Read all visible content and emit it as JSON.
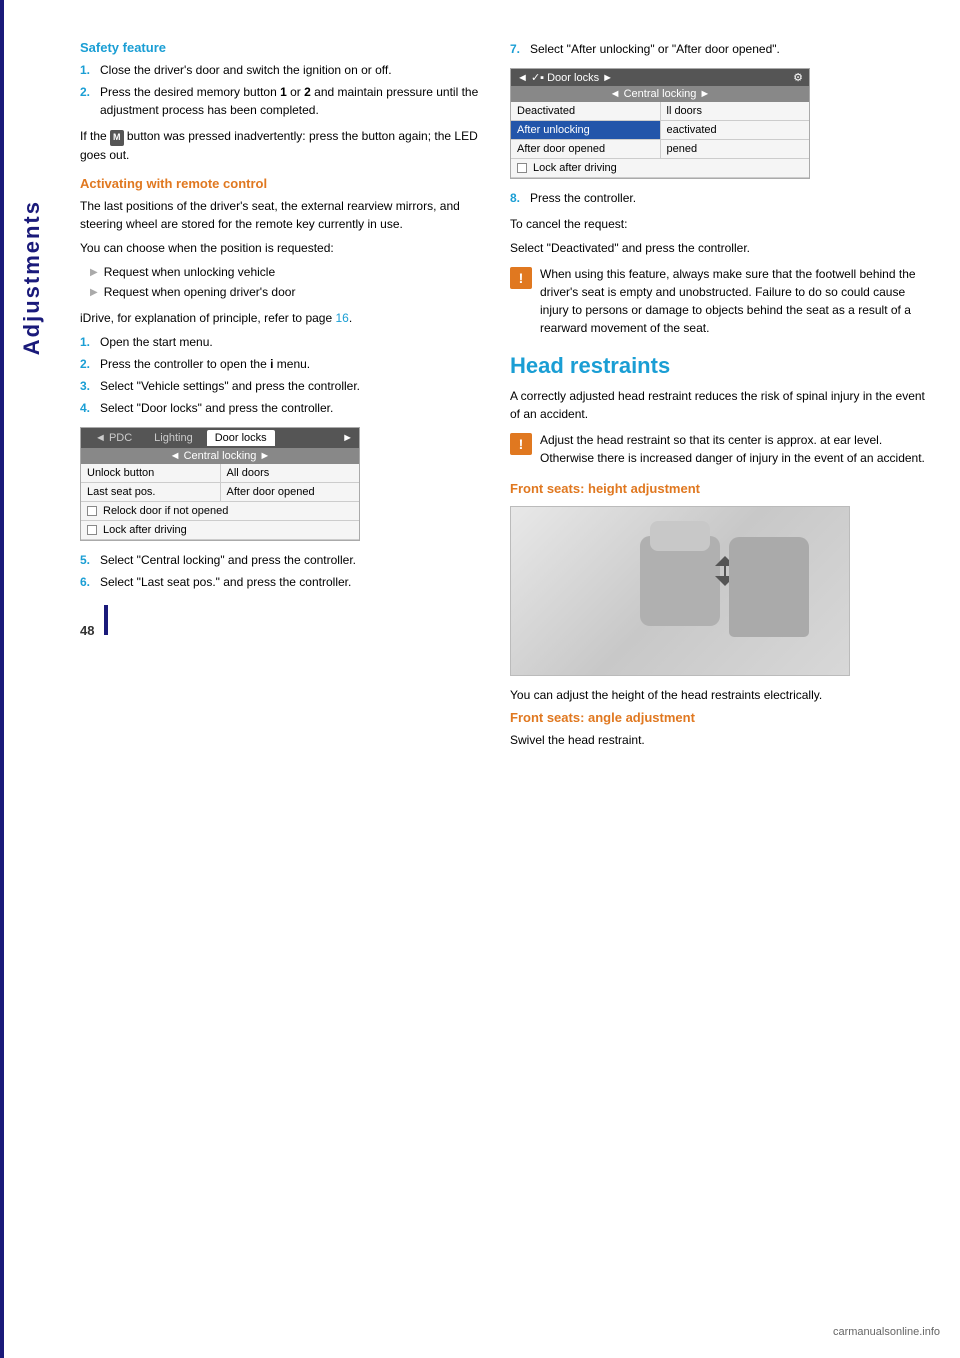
{
  "sidebar": {
    "label": "Adjustments",
    "accent_color": "#1a1a7a"
  },
  "page_number": "48",
  "left_col": {
    "safety_feature": {
      "title": "Safety feature",
      "steps": [
        {
          "num": "1.",
          "text": "Close the driver's door and switch the ignition on or off."
        },
        {
          "num": "2.",
          "text": "Press the desired memory button 1 or 2 and maintain pressure until the adjustment process has been completed."
        }
      ],
      "if_text": "If the",
      "if_text2": "button was pressed inadvertently: press the button again; the LED goes out."
    },
    "activating_remote": {
      "title": "Activating with remote control",
      "intro": "The last positions of the driver's seat, the external rearview mirrors, and steering wheel are stored for the remote key currently in use.",
      "choose": "You can choose when the position is requested:",
      "bullets": [
        "Request when unlocking vehicle",
        "Request when opening driver's door"
      ],
      "idrive_note": "iDrive, for explanation of principle, refer to page",
      "idrive_page": "16",
      "steps": [
        {
          "num": "1.",
          "text": "Open the start menu."
        },
        {
          "num": "2.",
          "text": "Press the controller to open the i menu."
        },
        {
          "num": "3.",
          "text": "Select \"Vehicle settings\" and press the controller."
        },
        {
          "num": "4.",
          "text": "Select \"Door locks\" and press the controller."
        }
      ],
      "menu1": {
        "tabs": [
          "PDC",
          "Lighting",
          "Door locks"
        ],
        "active_tab": "Door locks",
        "subheader": "Central locking",
        "rows": [
          {
            "col1": "Unlock button",
            "col2": "All doors"
          },
          {
            "col1": "Last seat pos.",
            "col2": "After door opened"
          }
        ],
        "checkboxes": [
          "Relock door if not opened",
          "Lock after driving"
        ]
      },
      "steps2": [
        {
          "num": "5.",
          "text": "Select \"Central locking\" and press the controller."
        },
        {
          "num": "6.",
          "text": "Select \"Last seat pos.\" and press the controller."
        }
      ]
    }
  },
  "right_col": {
    "step7": {
      "num": "7.",
      "text": "Select \"After unlocking\" or \"After door opened\"."
    },
    "menu2": {
      "header_left": "Door locks",
      "subheader": "Central locking",
      "rows": [
        {
          "col1": "Deactivated",
          "col2": "ll doors",
          "col1_active": false,
          "col2_active": false
        },
        {
          "col1": "After unlocking",
          "col2": "eactivated",
          "col1_active": true,
          "col2_active": false
        },
        {
          "col1": "After door opened",
          "col2": "pened",
          "col1_active": false,
          "col2_active": false
        }
      ],
      "checkbox": "Lock after driving"
    },
    "step8": {
      "num": "8.",
      "text": "Press the controller."
    },
    "cancel_text": "To cancel the request:",
    "cancel_text2": "Select \"Deactivated\" and press the controller.",
    "warning": "When using this feature, always make sure that the footwell behind the driver's seat is empty and unobstructed. Failure to do so could cause injury to persons or damage to objects behind the seat as a result of a rearward movement of the seat.",
    "head_restraints": {
      "title": "Head restraints",
      "intro": "A correctly adjusted head restraint reduces the risk of spinal injury in the event of an accident.",
      "warning": "Adjust the head restraint so that its center is approx. at ear level. Otherwise there is increased danger of injury in the event of an accident.",
      "front_seats_height": {
        "title": "Front seats: height adjustment",
        "text": "You can adjust the height of the head restraints electrically."
      },
      "front_seats_angle": {
        "title": "Front seats: angle adjustment",
        "text": "Swivel the head restraint."
      }
    }
  },
  "footer": {
    "site": "carmanualsonline.info"
  }
}
